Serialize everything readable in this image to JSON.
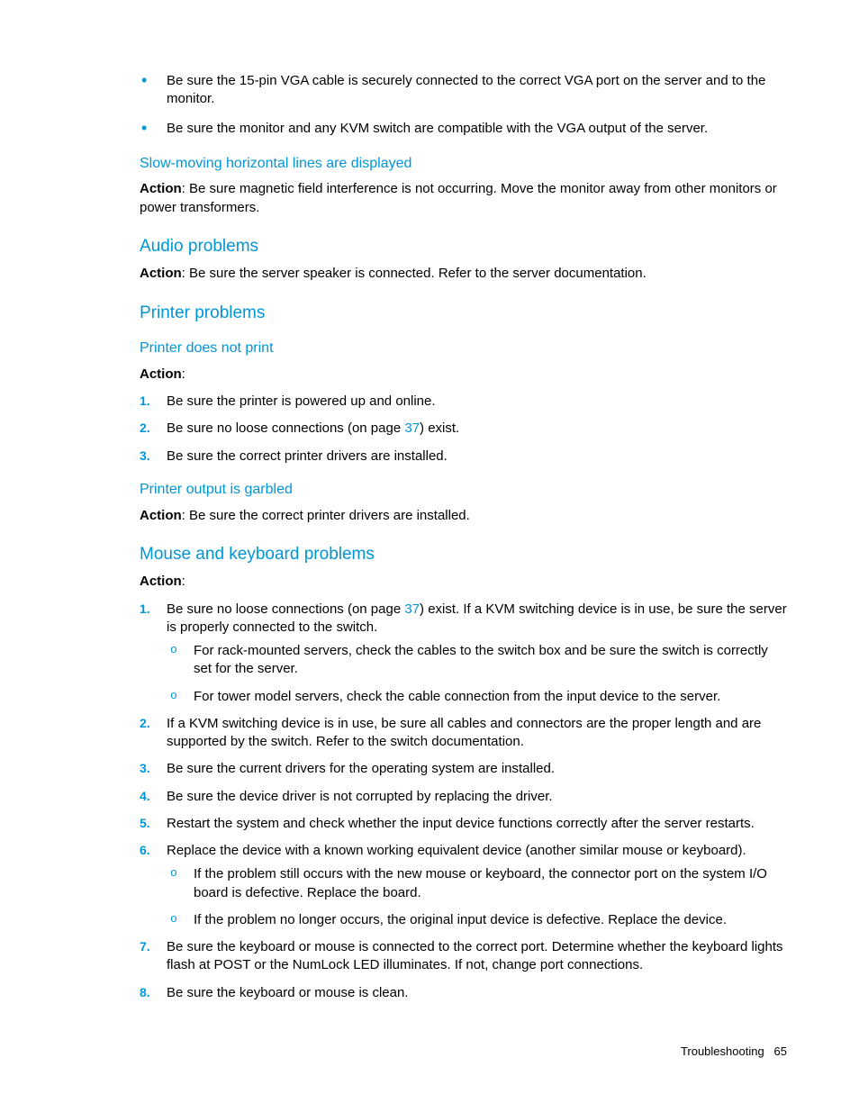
{
  "top_bullets": [
    "Be sure the 15-pin VGA cable is securely connected to the correct VGA port on the server and to the monitor.",
    "Be sure the monitor and any KVM switch are compatible with the VGA output of the server."
  ],
  "slow_lines": {
    "heading": "Slow-moving horizontal lines are displayed",
    "action_label": "Action",
    "action_text": ": Be sure magnetic field interference is not occurring. Move the monitor away from other monitors or power transformers."
  },
  "audio": {
    "heading": "Audio problems",
    "action_label": "Action",
    "action_text": ": Be sure the server speaker is connected. Refer to the server documentation."
  },
  "printer": {
    "heading": "Printer problems",
    "not_print": {
      "heading": "Printer does not print",
      "action_label": "Action",
      "colon": ":",
      "items_pre": "Be sure no loose connections (on page ",
      "page_link": "37",
      "items_post": ") exist.",
      "item1": "Be sure the printer is powered up and online.",
      "item3": "Be sure the correct printer drivers are installed."
    },
    "garbled": {
      "heading": "Printer output is garbled",
      "action_label": "Action",
      "action_text": ": Be sure the correct printer drivers are installed."
    }
  },
  "mouse": {
    "heading": "Mouse and keyboard problems",
    "action_label": "Action",
    "colon": ":",
    "i1_pre": "Be sure no loose connections (on page ",
    "i1_link": "37",
    "i1_post": ") exist. If a KVM switching device is in use, be sure the server is properly connected to the switch.",
    "i1_sub1": "For rack-mounted servers, check the cables to the switch box and be sure the switch is correctly set for the server.",
    "i1_sub2": "For tower model servers, check the cable connection from the input device to the server.",
    "i2": "If a KVM switching device is in use, be sure all cables and connectors are the proper length and are supported by the switch. Refer to the switch documentation.",
    "i3": "Be sure the current drivers for the operating system are installed.",
    "i4": "Be sure the device driver is not corrupted by replacing the driver.",
    "i5": "Restart the system and check whether the input device functions correctly after the server restarts.",
    "i6": "Replace the device with a known working equivalent device (another similar mouse or keyboard).",
    "i6_sub1": "If the problem still occurs with the new mouse or keyboard, the connector port on the system I/O board is defective. Replace the board.",
    "i6_sub2": "If the problem no longer occurs, the original input device is defective. Replace the device.",
    "i7": "Be sure the keyboard or mouse is connected to the correct port. Determine whether the keyboard lights flash at POST or the NumLock LED illuminates. If not, change port connections.",
    "i8": "Be sure the keyboard or mouse is clean."
  },
  "footer": {
    "section": "Troubleshooting",
    "page": "65"
  }
}
